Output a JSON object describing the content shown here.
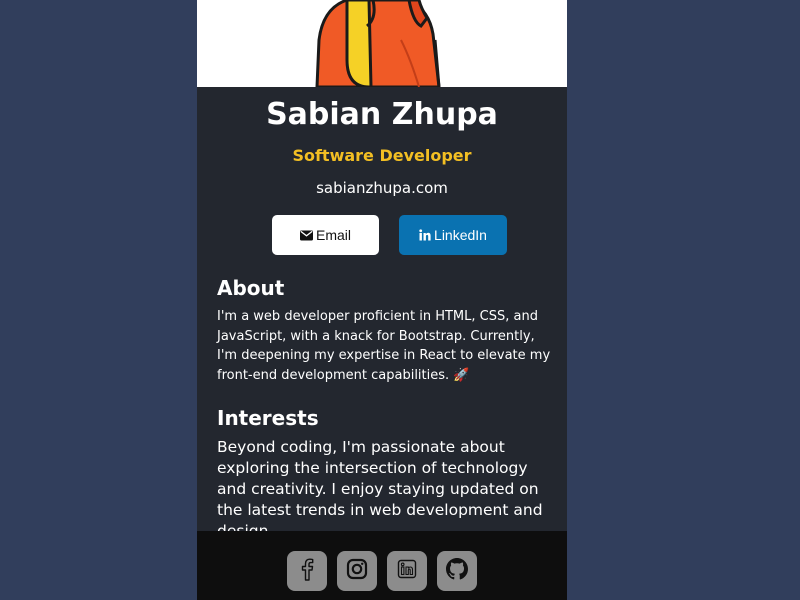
{
  "profile": {
    "name": "Sabian Zhupa",
    "role": "Software Developer",
    "website": "sabianzhupa.com"
  },
  "buttons": {
    "email_label": "Email",
    "linkedin_label": "LinkedIn"
  },
  "about": {
    "title": "About",
    "text": "I'm a web developer proficient in HTML, CSS, and JavaScript, with a knack for Bootstrap. Currently, I'm deepening my expertise in React to elevate my front-end development capabilities. 🚀"
  },
  "interests": {
    "title": "Interests",
    "text": "Beyond coding, I'm passionate about exploring the intersection of technology and creativity. I enjoy staying updated on the latest trends in web development and design."
  },
  "social": [
    "facebook-icon",
    "instagram-icon",
    "linkedin-icon",
    "github-icon"
  ],
  "colors": {
    "page_bg": "#313e5c",
    "card_bg": "#23272f",
    "accent": "#f3bf23",
    "linkedin": "#0a72b1",
    "footer_bg": "#0e0e0e"
  }
}
